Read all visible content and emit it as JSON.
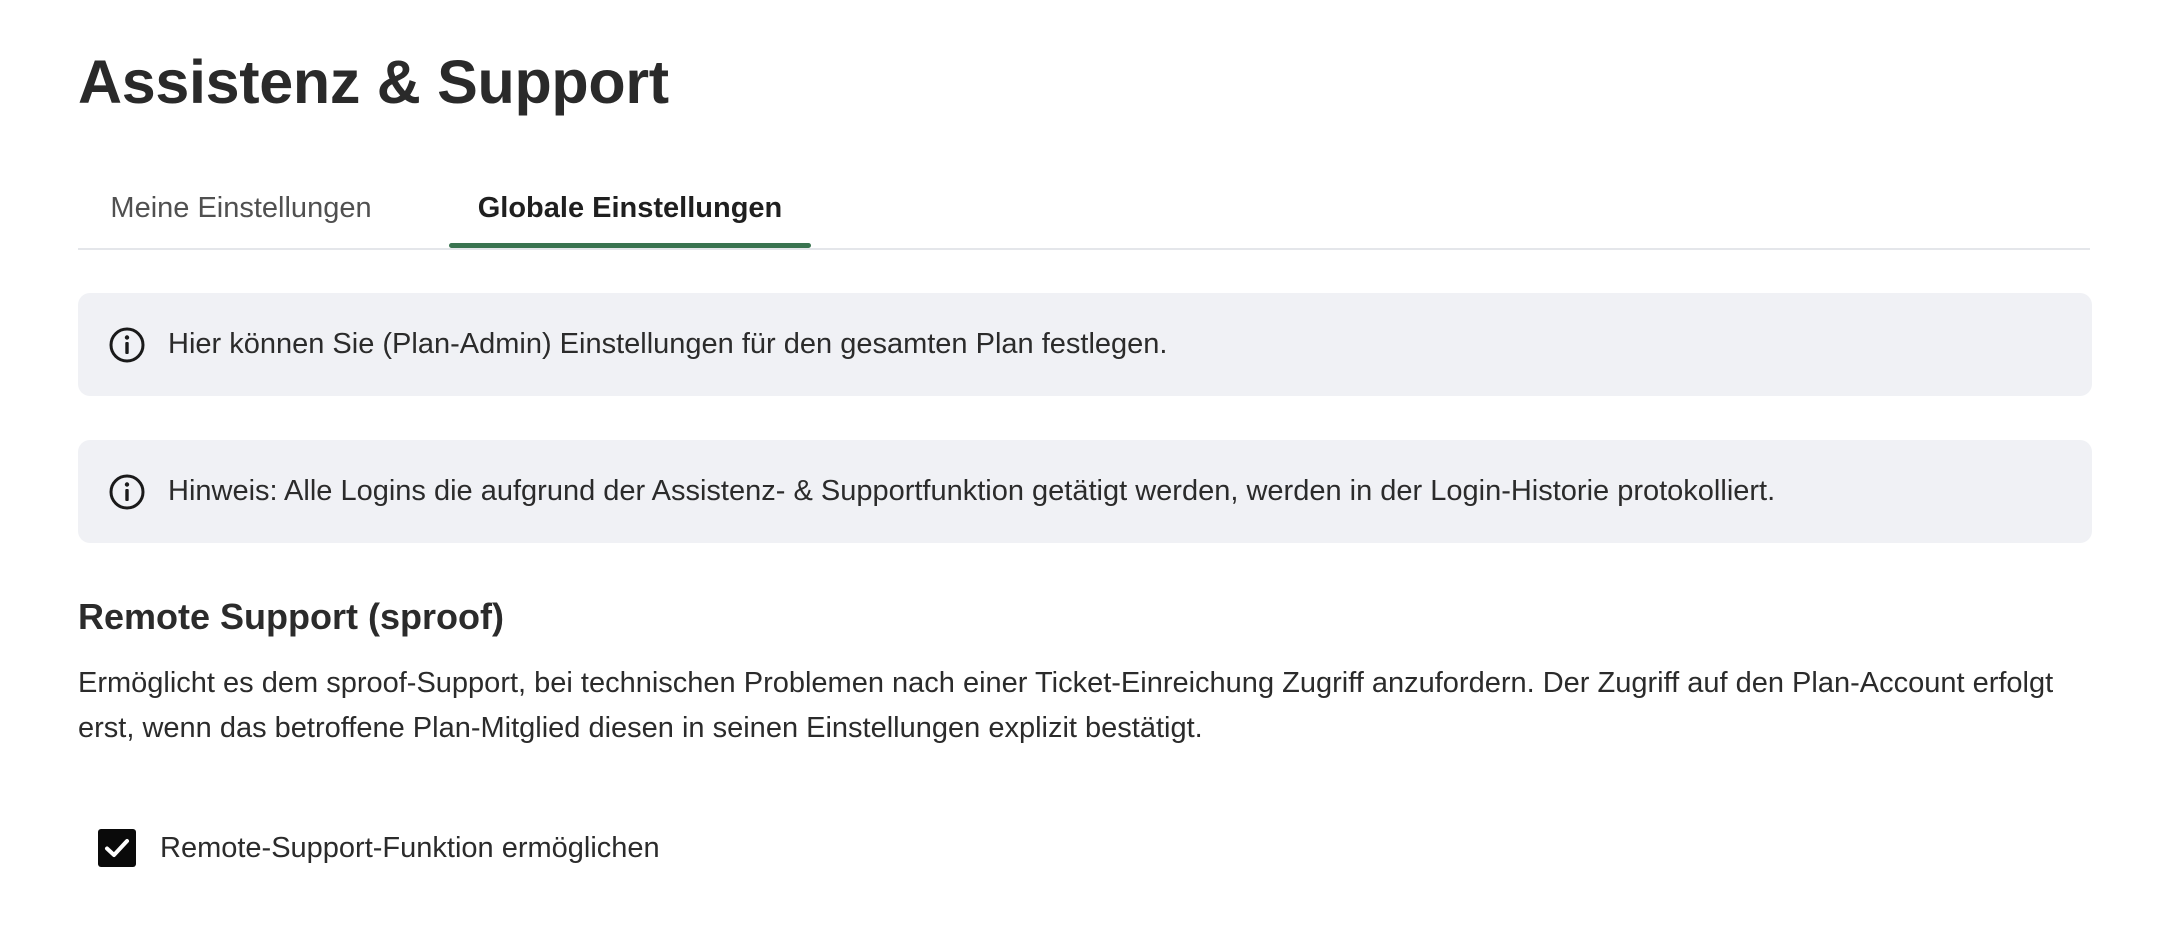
{
  "page": {
    "title": "Assistenz & Support"
  },
  "tabs": [
    {
      "label": "Meine Einstellungen",
      "active": false
    },
    {
      "label": "Globale Einstellungen",
      "active": true
    }
  ],
  "notices": [
    {
      "icon": "info-icon",
      "text": "Hier können Sie (Plan-Admin) Einstellungen für den gesamten Plan festlegen."
    },
    {
      "icon": "info-icon",
      "text": "Hinweis: Alle Logins die aufgrund der Assistenz- & Supportfunktion getätigt werden, werden in der Login-Historie protokolliert."
    }
  ],
  "remote_support": {
    "title": "Remote Support (sproof)",
    "description": "Ermöglicht es dem sproof-Support, bei technischen Problemen nach einer Ticket-Einreichung Zugriff anzufordern. Der Zugriff auf den Plan-Account erfolgt erst, wenn das betroffene Plan-Mitglied diesen in seinen Einstellungen explizit bestätigt.",
    "checkbox": {
      "label": "Remote-Support-Funktion ermöglichen",
      "checked": true
    }
  },
  "colors": {
    "accent": "#3a7450",
    "notice_background": "#f0f1f5",
    "text": "#2b2b2b"
  }
}
